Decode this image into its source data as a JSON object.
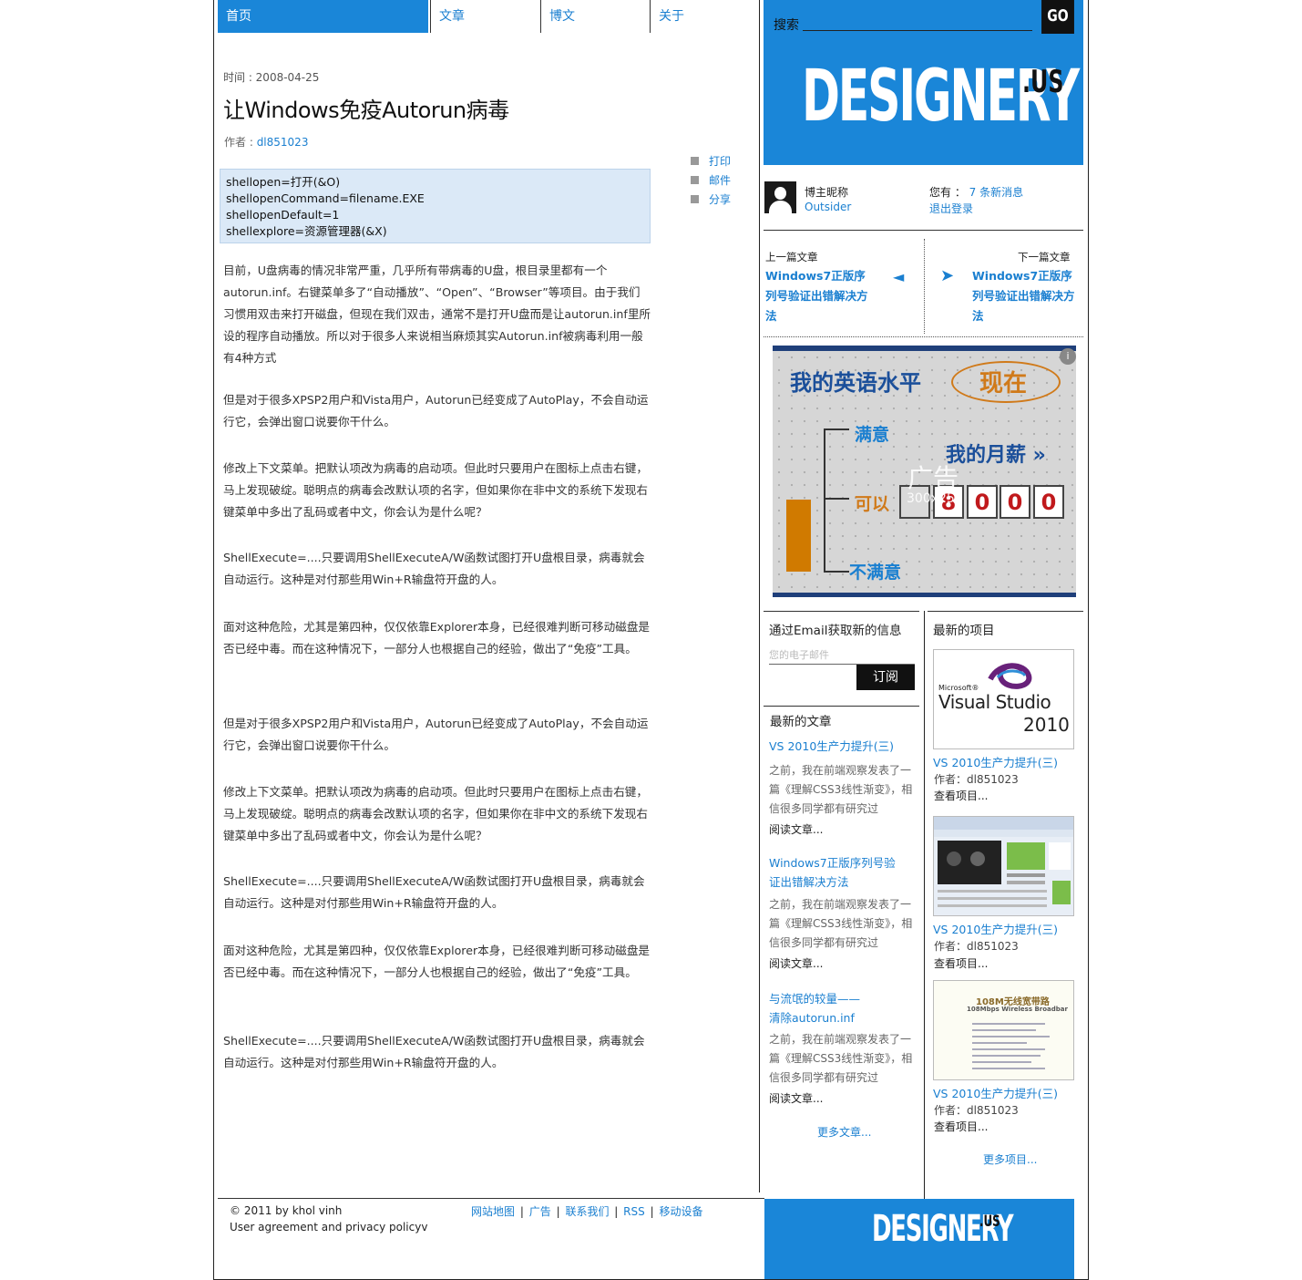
{
  "nav": {
    "tabs": [
      {
        "label": "首页",
        "active": true
      },
      {
        "label": "文章",
        "active": false
      },
      {
        "label": "博文",
        "active": false
      },
      {
        "label": "关于",
        "active": false
      }
    ]
  },
  "post": {
    "time": "时间 : 2008-04-25",
    "title": "让Windows免疫Autorun病毒",
    "author_label": "作者 : ",
    "author": "dl851023",
    "code_lines": [
      "shellopen=打开(&O)",
      "shellopenCommand=filename.EXE",
      "shellopenDefault=1",
      "shellexplore=资源管理器(&X)"
    ],
    "share": [
      "打印",
      "邮件",
      "分享"
    ],
    "paragraphs": [
      "目前，U盘病毒的情况非常严重，几乎所有带病毒的U盘，根目录里都有一个autorun.inf。右键菜单多了“自动播放”、“Open”、“Browser”等项目。由于我们习惯用双击来打开磁盘，但现在我们双击，通常不是打开U盘而是让autorun.inf里所设的程序自动播放。所以对于很多人来说相当麻烦其实Autorun.inf被病毒利用一般有4种方式",
      "但是对于很多XPSP2用户和Vista用户，Autorun已经变成了AutoPlay，不会自动运行它，会弹出窗口说要你干什么。",
      "修改上下文菜单。把默认项改为病毒的启动项。但此时只要用户在图标上点击右键，马上发现破绽。聪明点的病毒会改默认项的名字，但如果你在非中文的系统下发现右键菜单中多出了乱码或者中文，你会认为是什么呢？",
      "ShellExecute=....只要调用ShellExecuteA/W函数试图打开U盘根目录，病毒就会自动运行。这种是对付那些用Win+R输盘符开盘的人。",
      "面对这种危险，尤其是第四种，仅仅依靠Explorer本身，已经很难判断可移动磁盘是否已经中毒。而在这种情况下，一部分人也根据自己的经验，做出了“免疫”工具。",
      "但是对于很多XPSP2用户和Vista用户，Autorun已经变成了AutoPlay，不会自动运行它，会弹出窗口说要你干什么。",
      "修改上下文菜单。把默认项改为病毒的启动项。但此时只要用户在图标上点击右键，马上发现破绽。聪明点的病毒会改默认项的名字，但如果你在非中文的系统下发现右键菜单中多出了乱码或者中文，你会认为是什么呢？",
      "ShellExecute=....只要调用ShellExecuteA/W函数试图打开U盘根目录，病毒就会自动运行。这种是对付那些用Win+R输盘符开盘的人。",
      "面对这种危险，尤其是第四种，仅仅依靠Explorer本身，已经很难判断可移动磁盘是否已经中毒。而在这种情况下，一部分人也根据自己的经验，做出了“免疫”工具。",
      "ShellExecute=....只要调用ShellExecuteA/W函数试图打开U盘根目录，病毒就会自动运行。这种是对付那些用Win+R输盘符开盘的人。"
    ]
  },
  "sidebar": {
    "search_label": "搜索",
    "go_label": "GO",
    "logo": "DESIGNERY",
    "logo_suffix": ".US",
    "user": {
      "label": "博主昵称",
      "name": "Outsider",
      "messages_prefix": "您有 ：",
      "messages_link": "7 条新消息",
      "logout": "退出登录"
    },
    "prev": {
      "label": "上一篇文章",
      "title": "Windows7正版序列号验证出错解决方法",
      "arrow": "◄"
    },
    "next": {
      "label": "下一篇文章",
      "title": "Windows7正版序列号验证出错解决方法",
      "arrow": "➤"
    },
    "ad": {
      "headline": "我的英语水平",
      "now": "现在",
      "satisfied": "满意",
      "salary": "我的月薪 »",
      "ok": "可以",
      "unsatisfied": "不满意",
      "digits": [
        "8",
        "0",
        "0",
        "0"
      ],
      "label": "广告",
      "size": "300x250",
      "info_icon": "i"
    },
    "email": {
      "title": "通过Email获取新的信息",
      "placeholder": "您的电子邮件",
      "subscribe": "订阅"
    },
    "recent": {
      "title": "最新的文章",
      "items": [
        {
          "title": "VS 2010生产力提升(三)",
          "desc": "之前，我在前端观察发表了一篇《理解CSS3线性渐变》，相信很多同学都有研究过",
          "more": "阅读文章..."
        },
        {
          "title": "Windows7正版序列号验证出错解决方法",
          "desc": "之前，我在前端观察发表了一篇《理解CSS3线性渐变》，相信很多同学都有研究过",
          "more": "阅读文章..."
        },
        {
          "title": "与流氓的较量——清除autorun.inf",
          "desc": "之前，我在前端观察发表了一篇《理解CSS3线性渐变》，相信很多同学都有研究过",
          "more": "阅读文章..."
        }
      ],
      "more": "更多文章..."
    },
    "projects": {
      "title": "最新的项目",
      "items": [
        {
          "name": "VS 2010生产力提升(三)",
          "author": "作者：dl851023",
          "more": "查看项目..."
        },
        {
          "name": "VS 2010生产力提升(三)",
          "author": "作者：dl851023",
          "more": "查看项目..."
        },
        {
          "name": "VS 2010生产力提升(三)",
          "author": "作者：dl851023",
          "more": "查看项目..."
        }
      ],
      "vs_brand": "Microsoft®",
      "vs_name": "Visual Studio",
      "vs_year": "2010",
      "router_title": "108M无线宽带路",
      "router_sub": "108Mbps Wireless Broadbar",
      "more": "更多项目..."
    }
  },
  "footer": {
    "copyright": "© 2011 by khol vinh",
    "agreement": "User agreement and privacy policyv",
    "links": [
      "网站地图",
      "广告",
      "联系我们",
      "RSS",
      "移动设备"
    ],
    "separator": "|",
    "logo": "DESIGNERY",
    "logo_suffix": ".US"
  },
  "colors": {
    "accent": "#1a86d8",
    "link": "#1a7fd0",
    "code_bg": "#dbe9f7"
  }
}
